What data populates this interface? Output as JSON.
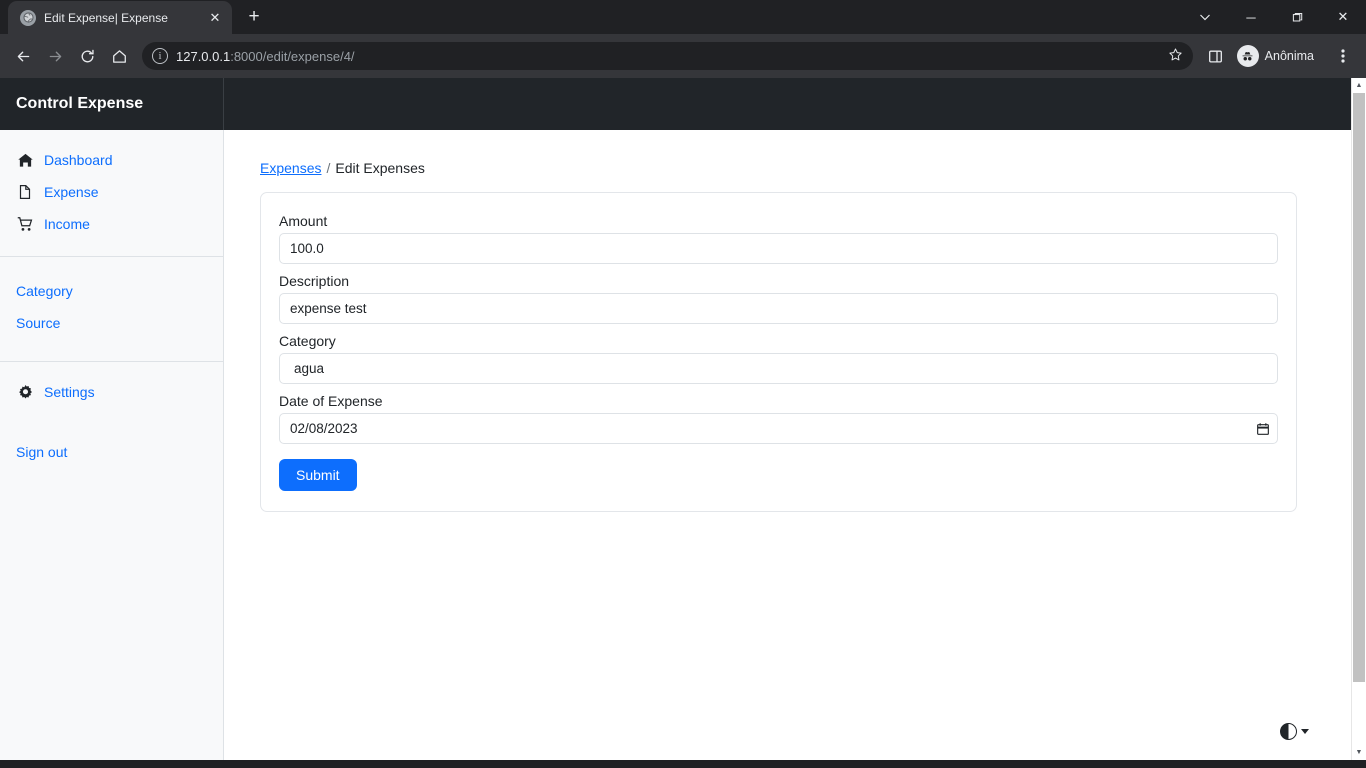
{
  "browser": {
    "tab": {
      "title": "Edit Expense| Expense",
      "favicon_icon": "globe-icon",
      "close_icon": "close-icon"
    },
    "new_tab_label": "+",
    "window_controls": {
      "tab_search_icon": "chevron-down-icon",
      "minimize_label": "─",
      "maximize_label": "❐",
      "close_label": "✕"
    },
    "toolbar": {
      "back_icon": "back-arrow-icon",
      "forward_icon": "forward-arrow-icon",
      "reload_icon": "reload-icon",
      "home_icon": "home-icon",
      "site_info_icon": "info-icon",
      "url_host": "127.0.0.1",
      "url_path": ":8000/edit/expense/4/",
      "bookmark_icon": "star-icon",
      "side_panel_icon": "side-panel-icon",
      "profile_label": "Anônima",
      "profile_icon": "incognito-icon",
      "menu_icon": "three-dots-icon"
    }
  },
  "topnav": {
    "brand": "Control Expense"
  },
  "sidebar": {
    "primary_items": [
      {
        "label": "Dashboard",
        "icon": "house-icon"
      },
      {
        "label": "Expense",
        "icon": "file-icon"
      },
      {
        "label": "Income",
        "icon": "cart-icon"
      }
    ],
    "secondary_items": [
      {
        "label": "Category"
      },
      {
        "label": "Source"
      }
    ],
    "settings": {
      "label": "Settings",
      "icon": "gear-icon"
    },
    "signout": {
      "label": "Sign out"
    }
  },
  "breadcrumb": {
    "root_label": "Expenses",
    "separator": "/",
    "current_label": "Edit Expenses"
  },
  "form": {
    "amount": {
      "label": "Amount",
      "value": "100.0"
    },
    "description": {
      "label": "Description",
      "value": "expense test"
    },
    "category": {
      "label": "Category",
      "value": "agua"
    },
    "date": {
      "label": "Date of Expense",
      "value": "02/08/2023",
      "picker_icon": "calendar-icon"
    },
    "submit_label": "Submit"
  },
  "theme_toggle": {
    "icon": "contrast-half-circle-icon",
    "caret_icon": "caret-down-icon"
  },
  "scrollbar": {
    "up_icon": "scroll-up-arrow",
    "down_icon": "scroll-down-arrow"
  },
  "colors": {
    "accent": "#0d6efd",
    "navbar": "#212529",
    "sidebar_bg": "#f8f9fa",
    "chrome_dark": "#202124"
  }
}
